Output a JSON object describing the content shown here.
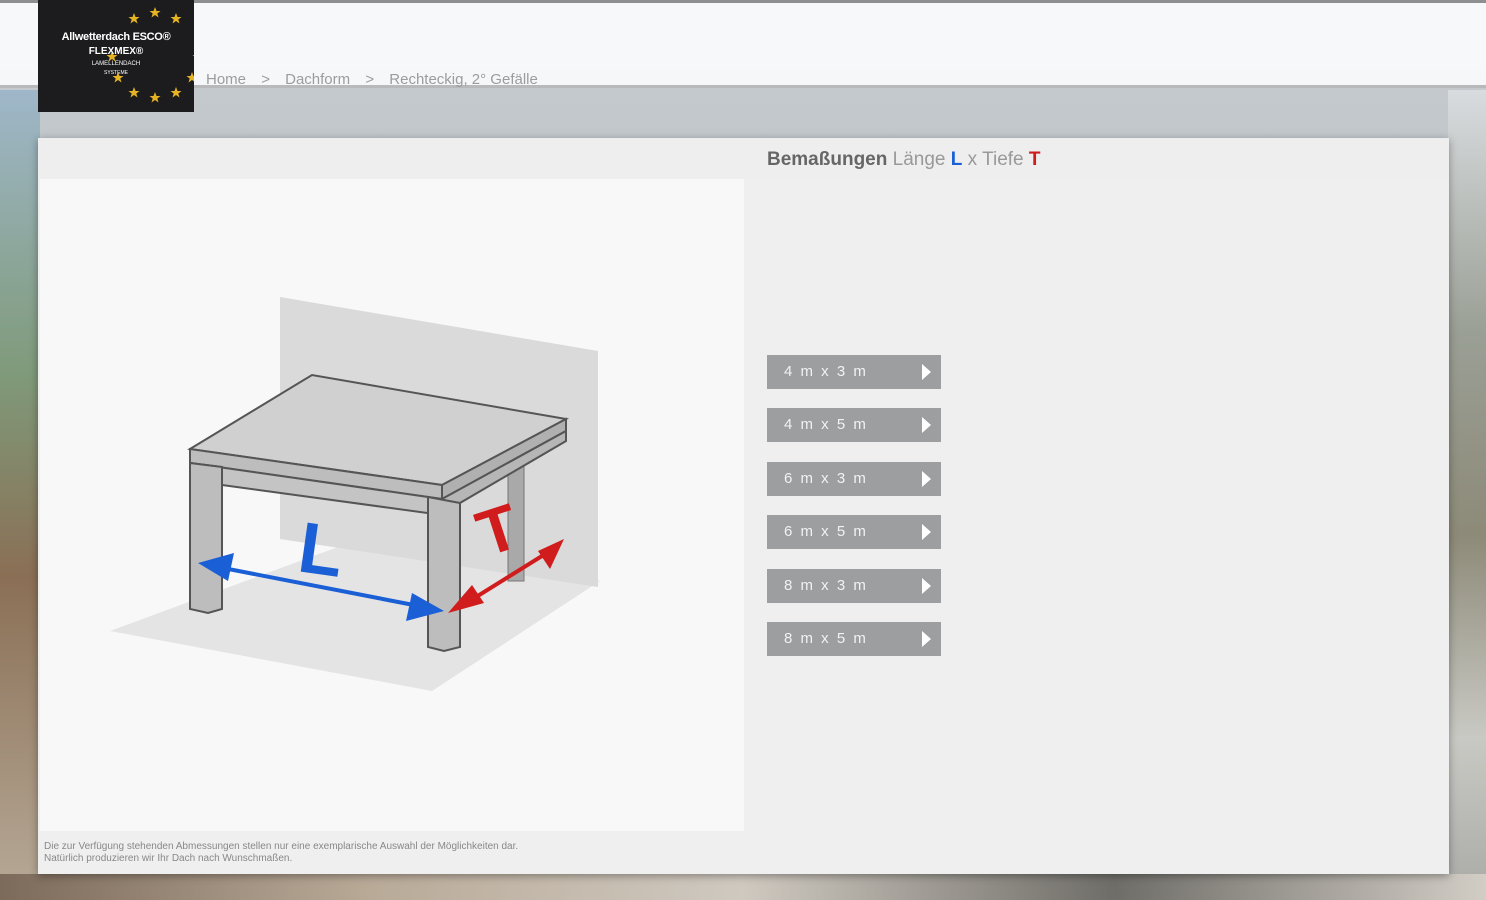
{
  "logo": {
    "line1": "Allwetterdach ESCO®",
    "line2": "FLEXMEX®",
    "line3": "LAMELLENDACH",
    "line4": "SYSTEME"
  },
  "breadcrumb": {
    "items": [
      "Home",
      "Dachform",
      "Rechteckig, 2° Gefälle"
    ],
    "separator": ">"
  },
  "heading": {
    "bold": "Bemaßungen",
    "laenge": "Länge",
    "L": "L",
    "x": "x",
    "tiefe": "Tiefe",
    "T": "T"
  },
  "illustration": {
    "label_L": "L",
    "label_T": "T"
  },
  "sizes": [
    "4 m x 3 m",
    "4 m x 5 m",
    "6 m x 3 m",
    "6 m x 5 m",
    "8 m x 3 m",
    "8 m x 5 m"
  ],
  "footnote": {
    "line1": "Die zur Verfügung stehenden Abmessungen stellen nur eine exemplarische Auswahl der Möglichkeiten dar.",
    "line2": "Natürlich produzieren wir Ihr Dach nach Wunschmaßen."
  },
  "colors": {
    "length_blue": "#1a5fd6",
    "depth_red": "#d01c1c",
    "button_grey": "#9d9e9f"
  }
}
